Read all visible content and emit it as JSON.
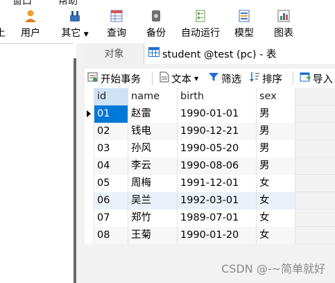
{
  "top_menu": {
    "item1": "窗口",
    "item2": "帮助"
  },
  "toolbar": {
    "users": "用户",
    "others": "其它",
    "query": "查询",
    "backup": "备份",
    "automation": "自动运行",
    "model": "模型",
    "chart": "图表"
  },
  "tabs": {
    "objects": "对象",
    "active": "student @test (pc) - 表"
  },
  "sub_toolbar": {
    "begin_transaction": "开始事务",
    "text": "文本",
    "filter": "筛选",
    "sort": "排序",
    "import": "导入"
  },
  "table": {
    "columns": [
      "id",
      "name",
      "birth",
      "sex"
    ],
    "rows": [
      [
        "01",
        "赵雷",
        "1990-01-01",
        "男"
      ],
      [
        "02",
        "钱电",
        "1990-12-21",
        "男"
      ],
      [
        "03",
        "孙风",
        "1990-05-20",
        "男"
      ],
      [
        "04",
        "李云",
        "1990-08-06",
        "男"
      ],
      [
        "05",
        "周梅",
        "1991-12-01",
        "女"
      ],
      [
        "06",
        "吴兰",
        "1992-03-01",
        "女"
      ],
      [
        "07",
        "郑竹",
        "1989-07-01",
        "女"
      ],
      [
        "08",
        "王菊",
        "1990-01-20",
        "女"
      ]
    ]
  },
  "watermark": "CSDN @-~简单就好",
  "colors": {
    "selection": "#0078d7",
    "accent": "#1e6fd0"
  }
}
